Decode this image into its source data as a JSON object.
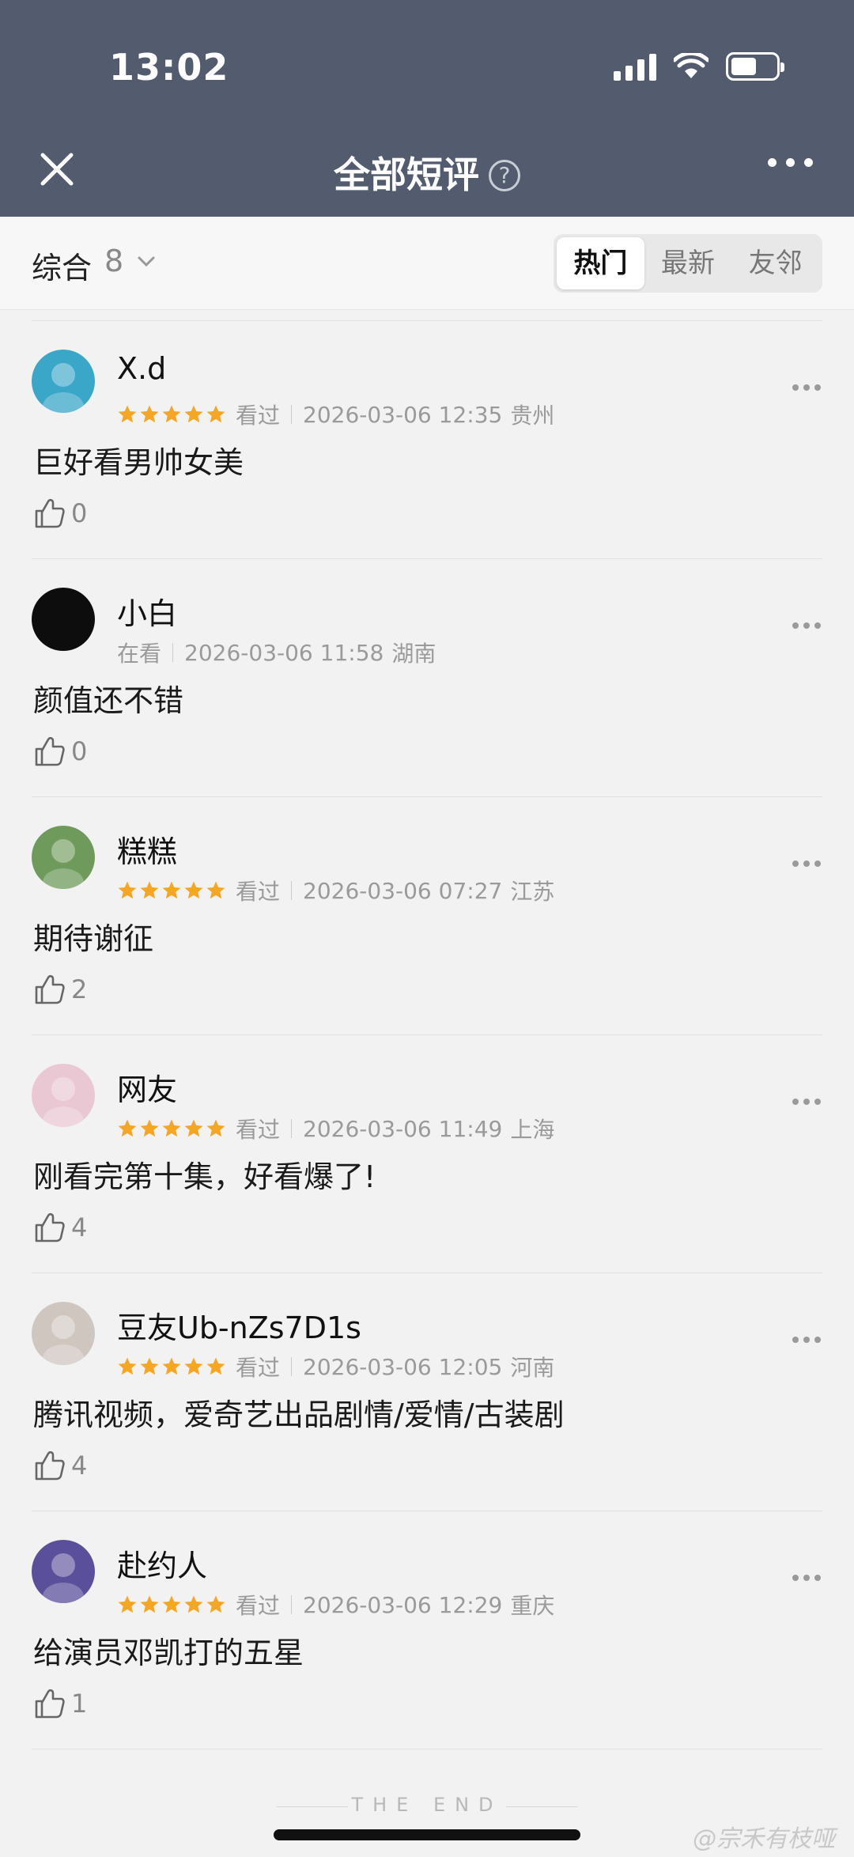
{
  "status_bar": {
    "time": "13:02"
  },
  "nav": {
    "title": "全部短评",
    "help": "?"
  },
  "filter": {
    "sort_label": "综合",
    "sort_count": "8",
    "tabs": [
      {
        "label": "热门",
        "active": true
      },
      {
        "label": "最新",
        "active": false
      },
      {
        "label": "友邻",
        "active": false
      }
    ]
  },
  "reviews": [
    {
      "user": "X.d",
      "rating": 5,
      "status": "看过",
      "datetime": "2026-03-06 12:35",
      "location": "贵州",
      "text": "巨好看男帅女美",
      "likes": "0",
      "avatar_color": "#3aa7c9"
    },
    {
      "user": "小白",
      "rating": 0,
      "status": "在看",
      "datetime": "2026-03-06 11:58",
      "location": "湖南",
      "text": "颜值还不错",
      "likes": "0",
      "avatar_color": "#0d0d0d"
    },
    {
      "user": "糕糕",
      "rating": 5,
      "status": "看过",
      "datetime": "2026-03-06 07:27",
      "location": "江苏",
      "text": "期待谢征",
      "likes": "2",
      "avatar_color": "#6e9a5b"
    },
    {
      "user": "网友",
      "rating": 5,
      "status": "看过",
      "datetime": "2026-03-06 11:49",
      "location": "上海",
      "text": "刚看完第十集，好看爆了!",
      "likes": "4",
      "avatar_color": "#e9c7d3"
    },
    {
      "user": "豆友Ub-nZs7D1s",
      "rating": 5,
      "status": "看过",
      "datetime": "2026-03-06 12:05",
      "location": "河南",
      "text": "腾讯视频，爱奇艺出品剧情/爱情/古装剧",
      "likes": "4",
      "avatar_color": "#cfc6c0"
    },
    {
      "user": "赴约人",
      "rating": 5,
      "status": "看过",
      "datetime": "2026-03-06 12:29",
      "location": "重庆",
      "text": "给演员邓凯打的五星",
      "likes": "1",
      "avatar_color": "#5a4f9a"
    }
  ],
  "footer": {
    "end_text": "THE END",
    "watermark": "@宗禾有枝哑"
  },
  "colors": {
    "header_bg": "#525c6e",
    "star": "#f5a623",
    "page_bg": "#f2f2f2"
  }
}
